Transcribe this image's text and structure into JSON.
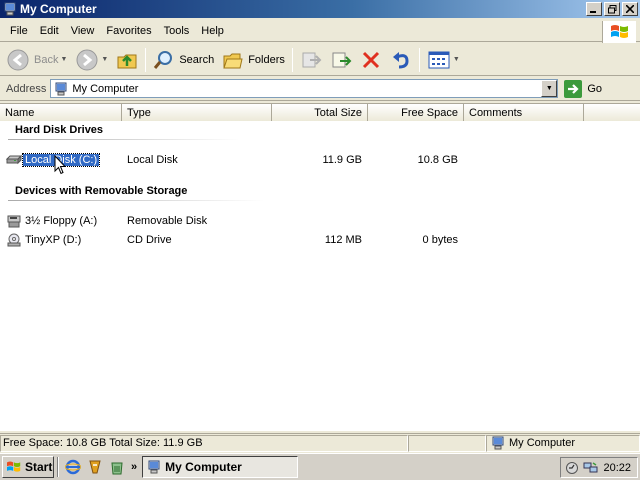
{
  "window": {
    "title": "My Computer"
  },
  "menu": [
    {
      "label": "File"
    },
    {
      "label": "Edit"
    },
    {
      "label": "View"
    },
    {
      "label": "Favorites"
    },
    {
      "label": "Tools"
    },
    {
      "label": "Help"
    }
  ],
  "toolbar": {
    "back_label": "Back",
    "search_label": "Search",
    "folders_label": "Folders"
  },
  "address": {
    "label": "Address",
    "value": "My Computer",
    "go_label": "Go"
  },
  "columns": [
    "Name",
    "Type",
    "Total Size",
    "Free Space",
    "Comments"
  ],
  "groups": [
    {
      "title": "Hard Disk Drives",
      "items": [
        {
          "name": "Local Disk (C:)",
          "type": "Local Disk",
          "total": "11.9 GB",
          "free": "10.8 GB",
          "icon": "hard-disk-icon",
          "selected": true
        }
      ]
    },
    {
      "title": "Devices with Removable Storage",
      "items": [
        {
          "name": "3½ Floppy (A:)",
          "type": "Removable Disk",
          "total": "",
          "free": "",
          "icon": "floppy-icon"
        },
        {
          "name": "TinyXP (D:)",
          "type": "CD Drive",
          "total": "112 MB",
          "free": "0 bytes",
          "icon": "cd-drive-icon"
        }
      ]
    }
  ],
  "status": {
    "space": "Free Space: 10.8 GB Total Size: 11.9 GB",
    "location": "My Computer"
  },
  "taskbar": {
    "start_label": "Start",
    "task_label": "My Computer",
    "clock": "20:22"
  },
  "colors": {
    "title_bar": "#0a246a",
    "selection": "#316ac5",
    "go_green": "#3c9a3c"
  }
}
